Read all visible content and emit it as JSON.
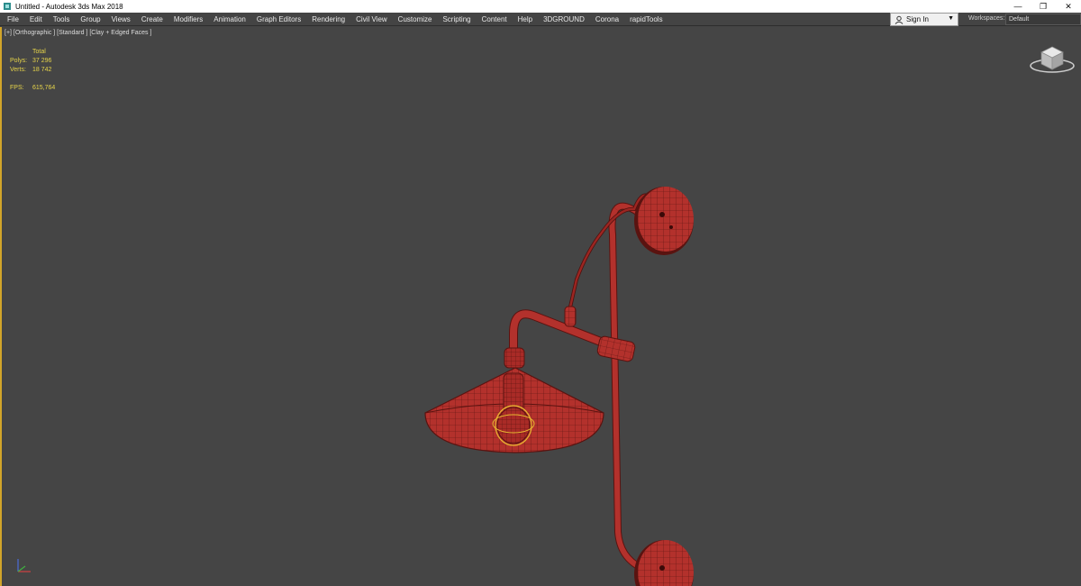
{
  "window": {
    "title": "Untitled - Autodesk 3ds Max 2018",
    "controls": [
      "minimize-icon",
      "restore-icon",
      "close-icon"
    ]
  },
  "menu": [
    "File",
    "Edit",
    "Tools",
    "Group",
    "Views",
    "Create",
    "Modifiers",
    "Animation",
    "Graph Editors",
    "Rendering",
    "Civil View",
    "Customize",
    "Scripting",
    "Content",
    "Help",
    "3DGROUND",
    "Corona",
    "rapidTools"
  ],
  "signin": {
    "label": "Sign In"
  },
  "workspaces": {
    "label": "Workspaces:",
    "value": "Default"
  },
  "viewport": {
    "label": "[+] [Orthographic ] [Standard ] [Clay + Edged Faces ]",
    "stats": {
      "header": "Total",
      "polys_label": "Polys:",
      "polys_value": "37 296",
      "verts_label": "Verts:",
      "verts_value": "18 742",
      "fps_label": "FPS:",
      "fps_value": "615,764"
    }
  },
  "colors": {
    "viewport_bg": "#454545",
    "model": "#b3312c",
    "wire": "#5a1310",
    "stats": "#e6d44a",
    "selection": "#e8b830"
  }
}
